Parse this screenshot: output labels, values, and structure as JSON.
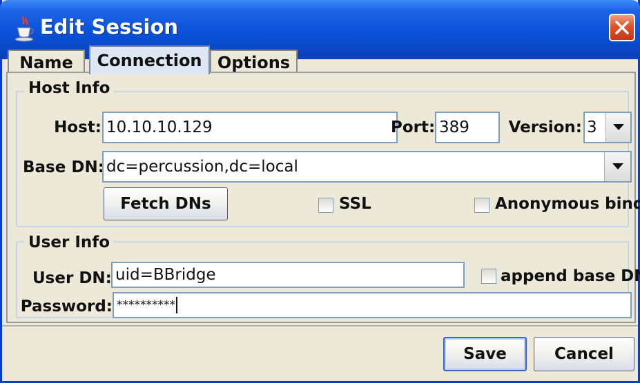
{
  "window": {
    "title": "Edit Session",
    "icon": "java-cup-icon"
  },
  "tabs": [
    {
      "label": "Name"
    },
    {
      "label": "Connection"
    },
    {
      "label": "Options"
    }
  ],
  "host_info": {
    "legend": "Host Info",
    "host_label": "Host:",
    "host_value": "10.10.10.129",
    "port_label": "Port:",
    "port_value": "389",
    "version_label": "Version:",
    "version_value": "3",
    "base_dn_label": "Base DN:",
    "base_dn_value": "dc=percussion,dc=local",
    "fetch_dns_label": "Fetch DNs",
    "ssl_label": "SSL",
    "ssl_checked": false,
    "anon_label": "Anonymous bind",
    "anon_checked": false
  },
  "user_info": {
    "legend": "User Info",
    "user_dn_label": "User DN:",
    "user_dn_value": "uid=BBridge",
    "append_label": "append base DN",
    "append_checked": false,
    "password_label": "Password:",
    "password_value": "**********"
  },
  "buttons": {
    "save": "Save",
    "cancel": "Cancel"
  }
}
